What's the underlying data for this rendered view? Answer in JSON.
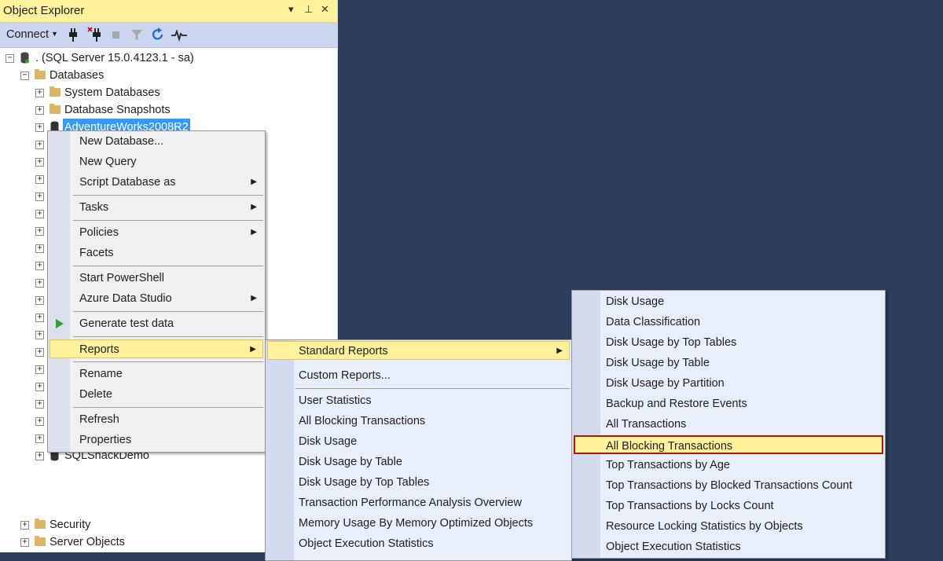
{
  "panel": {
    "title": "Object Explorer",
    "connect_label": "Connect"
  },
  "tree": {
    "server": ". (SQL Server 15.0.4123.1 - sa)",
    "databases": "Databases",
    "system_databases": "System Databases",
    "database_snapshots": "Database Snapshots",
    "selected_db": "AdventureWorks2008R2",
    "last_db": "SQLShackDemo",
    "security": "Security",
    "server_objects": "Server Objects"
  },
  "context_menu": {
    "items": [
      "New Database...",
      "New Query",
      "Script Database as",
      "Tasks",
      "Policies",
      "Facets",
      "Start PowerShell",
      "Azure Data Studio",
      "Generate test data",
      "Reports",
      "Rename",
      "Delete",
      "Refresh",
      "Properties"
    ]
  },
  "reports_menu": {
    "standard": "Standard Reports",
    "custom": "Custom Reports...",
    "items": [
      "User Statistics",
      "All Blocking Transactions",
      "Disk Usage",
      "Disk Usage by Table",
      "Disk Usage by Top Tables",
      "Transaction Performance Analysis Overview",
      "Memory Usage By Memory Optimized Objects",
      "Object Execution Statistics"
    ]
  },
  "standard_reports_menu": {
    "items": [
      "Disk Usage",
      "Data Classification",
      "Disk Usage by Top Tables",
      "Disk Usage by Table",
      "Disk Usage by Partition",
      "Backup and Restore Events",
      "All Transactions",
      "All Blocking Transactions",
      "Top Transactions by Age",
      "Top Transactions by Blocked Transactions Count",
      "Top Transactions by Locks Count",
      "Resource Locking Statistics by Objects",
      "Object Execution Statistics"
    ]
  },
  "colors": {
    "background": "#2d3e5c",
    "highlight": "#fff29d",
    "highlight_border": "#b0150d",
    "selection": "#3399ff"
  }
}
